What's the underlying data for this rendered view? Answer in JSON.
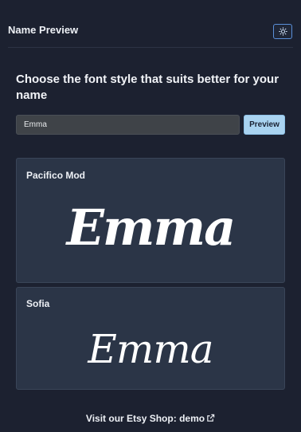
{
  "header": {
    "title": "Name Preview",
    "theme_icon": "sun-icon"
  },
  "main": {
    "heading": "Choose the font style that suits better for your name",
    "name_input": {
      "value": "Emma",
      "placeholder": ""
    },
    "preview_button_label": "Preview"
  },
  "fonts": [
    {
      "name": "Pacifico Mod",
      "preview_text": "Emma"
    },
    {
      "name": "Sofia",
      "preview_text": "Emma"
    }
  ],
  "footer": {
    "prefix": "Visit our Etsy Shop:",
    "link_label": "demo",
    "link_icon": "external-link-icon"
  },
  "colors": {
    "background": "#1c2130",
    "card": "#2b3547",
    "accent_button": "#a9d3f0",
    "toggle_border": "#5a8fd8"
  }
}
